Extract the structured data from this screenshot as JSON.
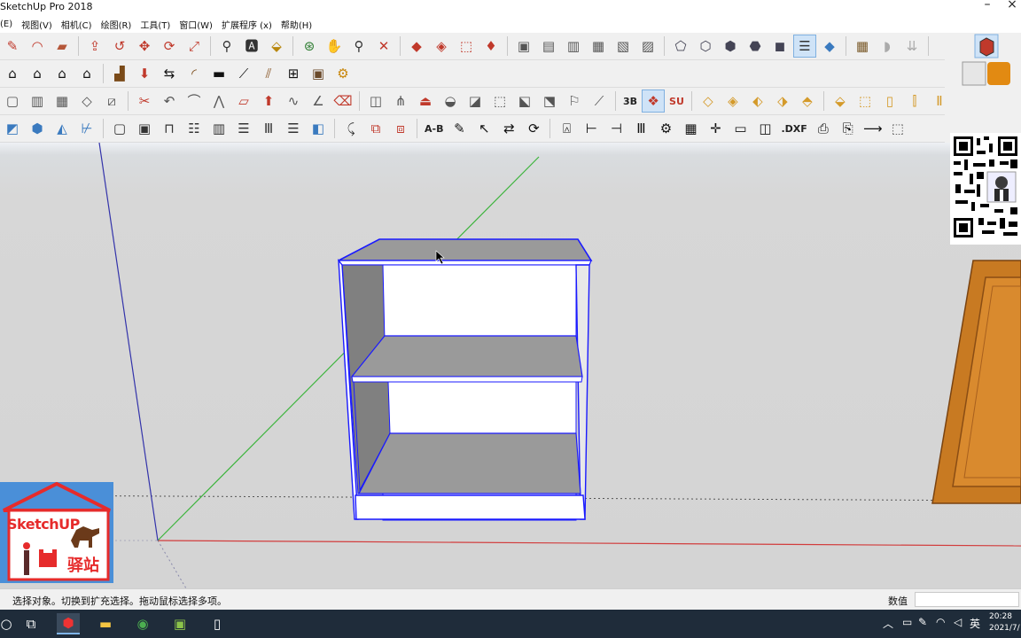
{
  "window": {
    "title": "SketchUp Pro 2018",
    "close_glyph": "×"
  },
  "menu": [
    {
      "label": "(E)"
    },
    {
      "label": "视图(V)"
    },
    {
      "label": "相机(C)"
    },
    {
      "label": "绘图(R)"
    },
    {
      "label": "工具(T)"
    },
    {
      "label": "窗口(W)"
    },
    {
      "label": "扩展程序 (x)"
    },
    {
      "label": "帮助(H)"
    }
  ],
  "toolbar_text": {
    "ab_label": "A-B",
    "dxf_label": ".DXF",
    "b3_label": "3B",
    "su_label": "SU"
  },
  "viewport": {
    "cursor_icon": "arrow-cursor-icon"
  },
  "logo": {
    "line1": "SketchUP",
    "line2": "驿站"
  },
  "status": {
    "message": "选择对象。切换到扩充选择。拖动鼠标选择多项。",
    "value_label": "数值",
    "value": ""
  },
  "taskbar": {
    "ime": "英",
    "time": "20:28",
    "date": "2021/7/"
  },
  "colors": {
    "red_axis": "#d23c3c",
    "green_axis": "#3cb43c",
    "blue_axis": "#3333aa",
    "selection": "#1a1aff",
    "cabinet_face": "#ffffff",
    "cabinet_inner": "#8f8f8f",
    "door_wood": "#c87a22"
  }
}
